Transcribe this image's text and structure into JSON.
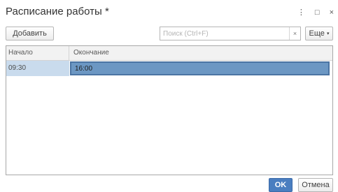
{
  "window": {
    "title": "Расписание работы *",
    "controls": {
      "menu_icon": "⋮",
      "maximize_icon": "□",
      "close_icon": "×"
    }
  },
  "toolbar": {
    "add_label": "Добавить",
    "search_placeholder": "Поиск (Ctrl+F)",
    "search_value": "",
    "clear_icon": "×",
    "more_label": "Еще",
    "more_caret": "▾"
  },
  "table": {
    "columns": [
      "Начало",
      "Окончание"
    ],
    "rows": [
      {
        "start": "09:30",
        "end": "16:00"
      }
    ]
  },
  "footer": {
    "ok_label": "OK",
    "cancel_label": "Отмена"
  },
  "colors": {
    "accent": "#4a7ec0",
    "selected_cell": "#6c97c3",
    "selected_row": "#c9dbed"
  }
}
